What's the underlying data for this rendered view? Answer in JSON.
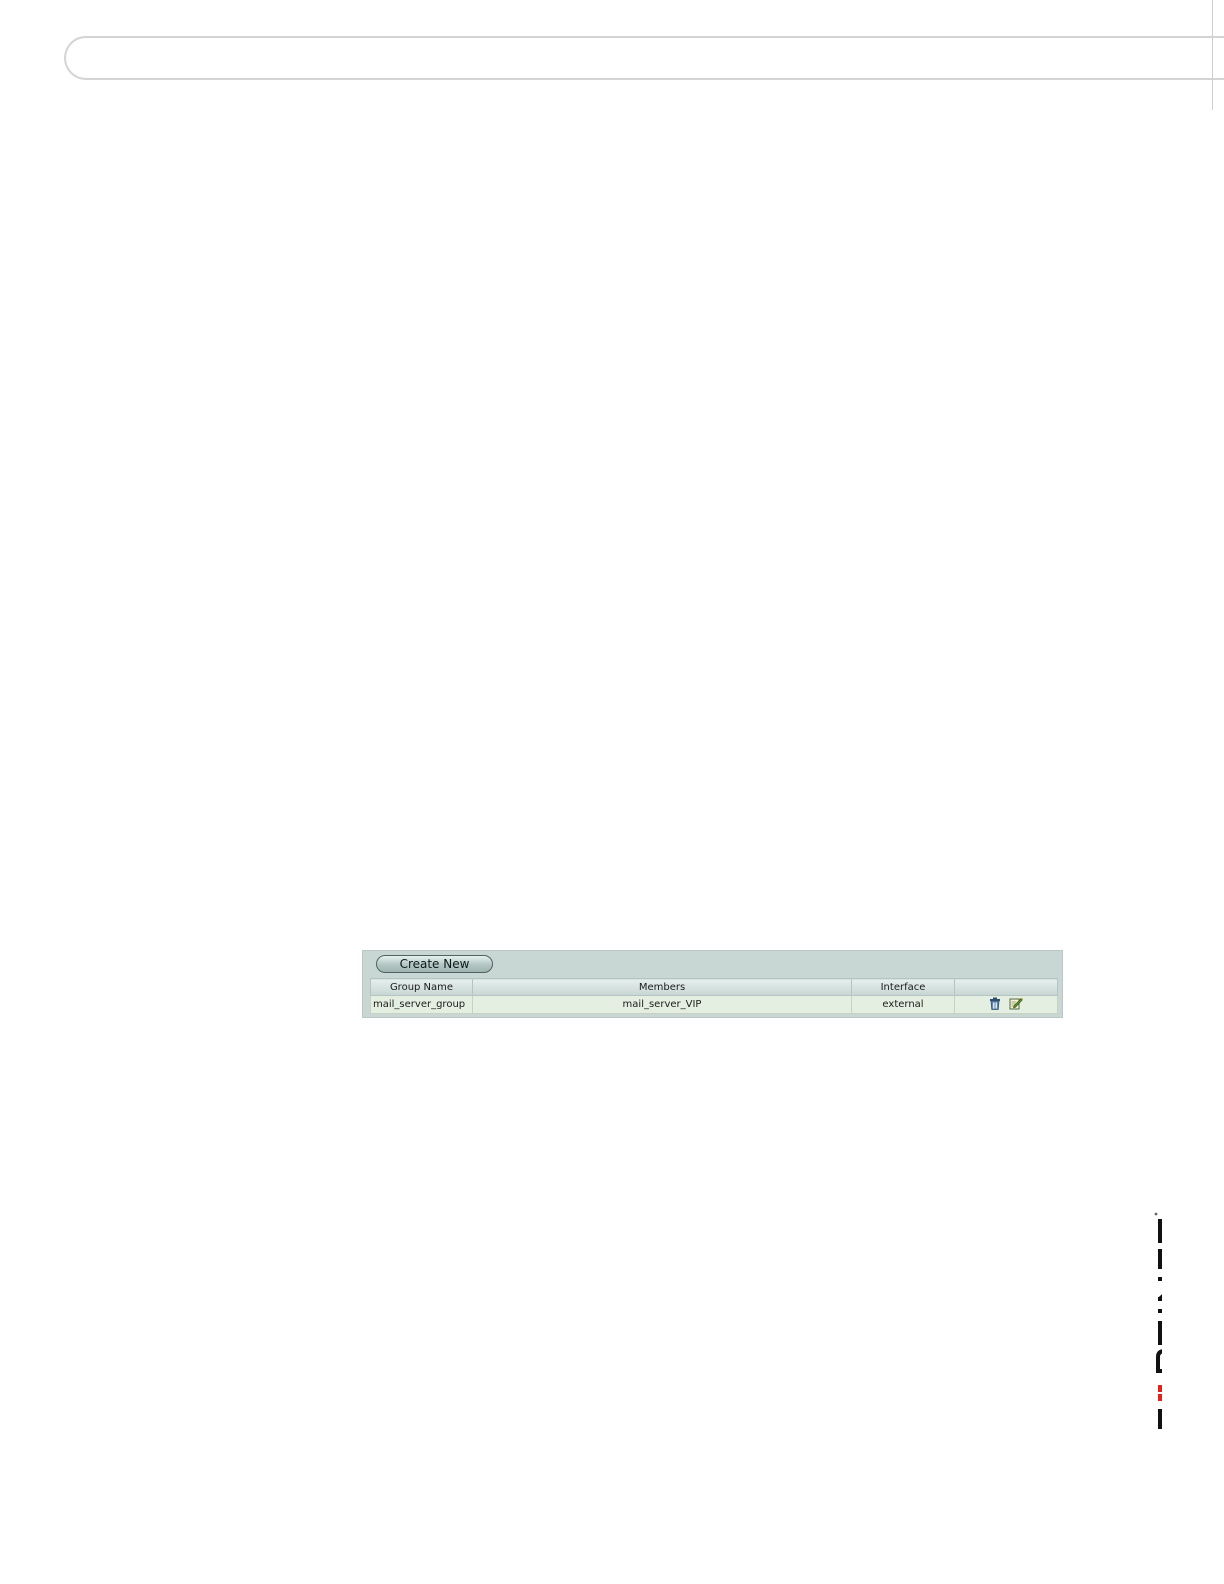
{
  "toolbar": {
    "create_label": "Create New"
  },
  "table": {
    "headers": [
      "Group Name",
      "Members",
      "Interface",
      ""
    ],
    "rows": [
      {
        "group_name": "mail_server_group",
        "members": "mail_server_VIP",
        "interface": "external",
        "actions": [
          "delete-icon",
          "edit-icon"
        ]
      }
    ]
  },
  "logo": {
    "text": "FORTINET",
    "accent_color": "#e2231a"
  },
  "colors": {
    "panel_background": "#c8d6d4",
    "row_background": "#e4efe1"
  }
}
